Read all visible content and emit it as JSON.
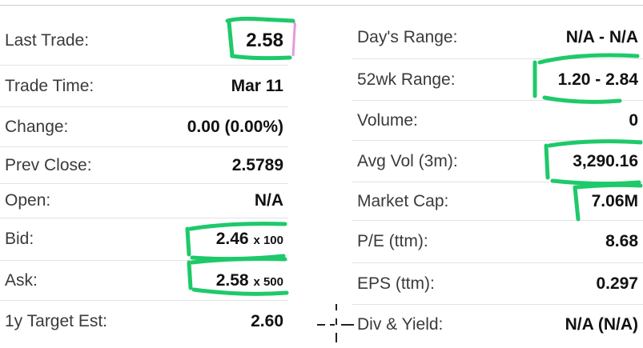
{
  "colors": {
    "marker_green": "#1ec96a",
    "marker_pink": "#e59ae0"
  },
  "left": [
    {
      "label": "Last Trade:",
      "value": "2.58"
    },
    {
      "label": "Trade Time:",
      "value": "Mar 11"
    },
    {
      "label": "Change:",
      "value": "0.00 (0.00%)"
    },
    {
      "label": "Prev Close:",
      "value": "2.5789"
    },
    {
      "label": "Open:",
      "value": "N/A"
    },
    {
      "label": "Bid:",
      "value": "2.46",
      "size": "x 100"
    },
    {
      "label": "Ask:",
      "value": "2.58",
      "size": "x 500"
    },
    {
      "label": "1y Target Est:",
      "value": "2.60"
    }
  ],
  "right": [
    {
      "label": "Day's Range:",
      "value": "N/A - N/A"
    },
    {
      "label": "52wk Range:",
      "value": "1.20 - 2.84"
    },
    {
      "label": "Volume:",
      "value": "0"
    },
    {
      "label": "Avg Vol (3m):",
      "value": "3,290.16"
    },
    {
      "label": "Market Cap:",
      "value": "7.06M"
    },
    {
      "label": "P/E (ttm):",
      "value": "8.68"
    },
    {
      "label": "EPS (ttm):",
      "value": "0.297"
    },
    {
      "label": "Div & Yield:",
      "value": "N/A (N/A)"
    }
  ]
}
